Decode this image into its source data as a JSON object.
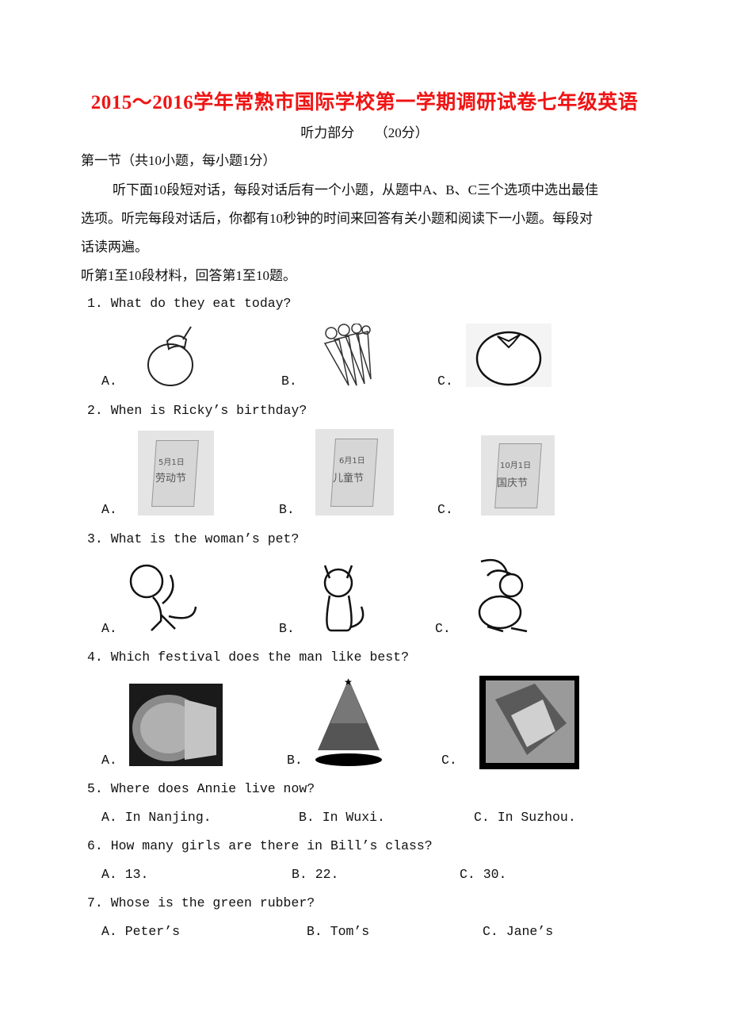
{
  "title": "2015～2016学年常熟市国际学校第一学期调研试卷七年级英语",
  "subtitle": "听力部分　　（20分）",
  "section": {
    "heading": "第一节（共10小题，每小题1分）",
    "instructions": [
      "听下面10段短对话，每段对话后有一个小题，从题中A、B、C三个选项中选出最佳",
      "选项。听完每段对话后，你都有10秒钟的时间来回答有关小题和阅读下一小题。每段对",
      "话读两遍。"
    ],
    "range": "听第1至10段材料，回答第1至10题。"
  },
  "questions": [
    {
      "q": "1. What do they eat today?",
      "options": [
        "A.",
        "B.",
        "C."
      ],
      "icons": [
        "eggplant-icon",
        "carrots-icon",
        "tomato-icon"
      ]
    },
    {
      "q": "2. When is Ricky’s birthday?",
      "options": [
        "A.",
        "B.",
        "C."
      ],
      "calendars": [
        {
          "date": "5月1日",
          "name": "劳动节"
        },
        {
          "date": "6月1日",
          "name": "儿童节"
        },
        {
          "date": "10月1日",
          "name": "国庆节"
        }
      ]
    },
    {
      "q": "3. What is the woman’s pet?",
      "options": [
        "A.",
        "B.",
        "C."
      ],
      "icons": [
        "monkey-icon",
        "cat-icon",
        "rabbit-icon"
      ]
    },
    {
      "q": "4. Which festival does the man like best?",
      "options": [
        "A.",
        "B.",
        "C."
      ],
      "icons": [
        "mooncake-icon",
        "christmas-tree-icon",
        "zongzi-icon"
      ]
    },
    {
      "q": "5. Where does Annie live now?",
      "options": [
        "A. In Nanjing.",
        "B. In Wuxi.",
        "C. In Suzhou."
      ]
    },
    {
      "q": "6. How many girls are there in Bill’s class?",
      "options": [
        "A. 13.",
        "B. 22.",
        "C. 30."
      ]
    },
    {
      "q": "7. Whose is the green rubber?",
      "options": [
        "A. Peter’s",
        "B. Tom’s",
        "C. Jane’s"
      ]
    }
  ]
}
